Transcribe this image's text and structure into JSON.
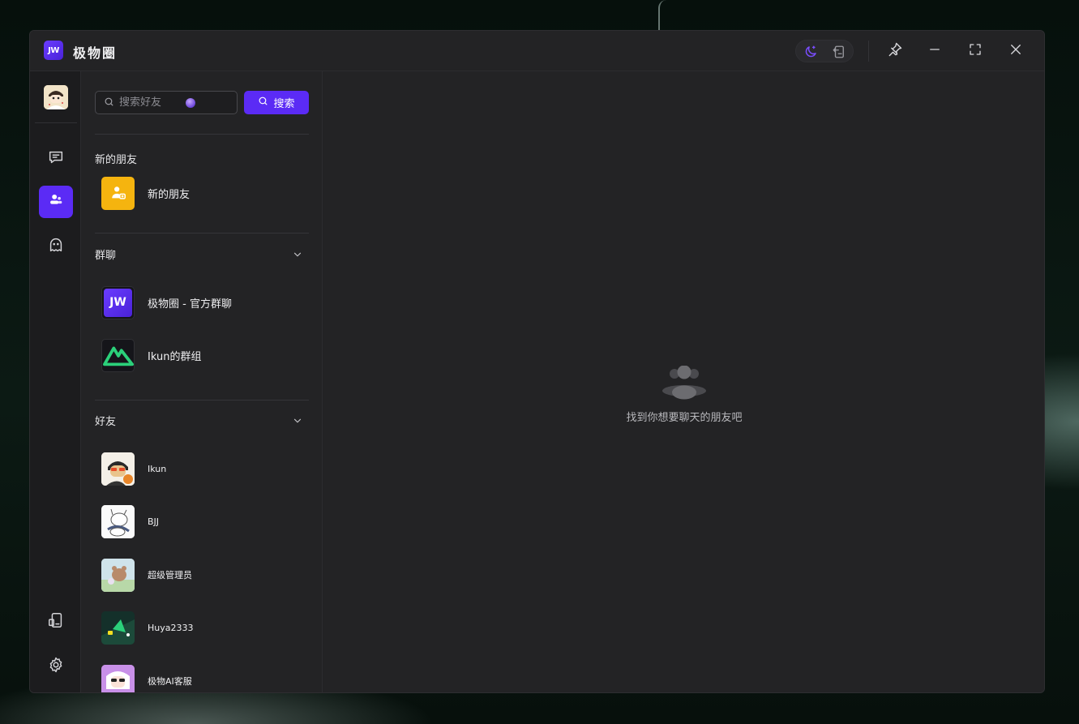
{
  "app": {
    "logo_text": "JW",
    "title": "极物圈"
  },
  "search": {
    "placeholder": "搜索好友",
    "button_label": "搜索"
  },
  "sections": {
    "new_friends": {
      "title": "新的朋友",
      "item_label": "新的朋友"
    },
    "groups": {
      "title": "群聊",
      "items": [
        {
          "name": "极物圈 - 官方群聊",
          "avatar_text": "JW"
        },
        {
          "name": "Ikun的群组"
        }
      ]
    },
    "friends": {
      "title": "好友",
      "items": [
        {
          "name": "Ikun"
        },
        {
          "name": "BJJ"
        },
        {
          "name": "超级管理员"
        },
        {
          "name": "Huya2333"
        },
        {
          "name": "极物AI客服"
        }
      ]
    }
  },
  "main": {
    "empty_text": "找到你想要聊天的朋友吧"
  },
  "colors": {
    "accent": "#5b2bf5",
    "new_friend_badge": "#f5b40f",
    "window_bg": "#232325",
    "rail_bg": "#1c1c1e",
    "group_brand": "#2bd07a"
  },
  "icons": {
    "rail": [
      "chat-icon",
      "contacts-icon",
      "ghost-icon",
      "device-icon",
      "settings-icon"
    ],
    "titlebar": [
      "moon-icon",
      "screen-icon",
      "pin-icon",
      "minimize-icon",
      "fullscreen-icon",
      "close-icon"
    ]
  }
}
